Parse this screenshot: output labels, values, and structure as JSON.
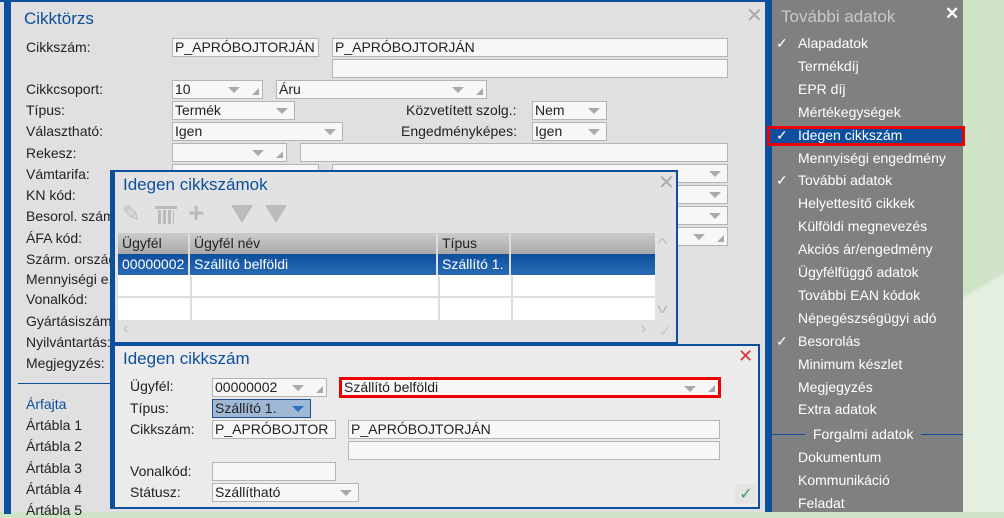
{
  "main": {
    "title": "Cikktörzs",
    "labels": {
      "cikkszam": "Cikkszám:",
      "cikkcsoport": "Cikkcsoport:",
      "tipus": "Típus:",
      "valaszthato": "Választható:",
      "rekesz": "Rekesz:",
      "vamtarifa": "Vámtarifa:",
      "kn": "KN kód:",
      "besorol": "Besorol. szám:",
      "afa": "ÁFA kód:",
      "szarm": "Szárm. ország:",
      "menny": "Mennyiségi e.:",
      "vonalkod": "Vonalkód:",
      "gyartasi": "Gyártásiszám:",
      "nyilv": "Nyilvántartás:",
      "megj": "Megjegyzés:",
      "kozv": "Közvetített szolg.:",
      "engedm": "Engedményképes:"
    },
    "values": {
      "cikkszam1": "P_APRÓBOJTORJÁN",
      "cikkszam2": "P_APRÓBOJTORJÁN",
      "cikkcsoport": "10",
      "cikkcsoport_name": "Áru",
      "tipus": "Termék",
      "valaszthato": "Igen",
      "kozv": "Nem",
      "engedm": "Igen"
    },
    "arfajta": "Árfajta",
    "artablak": [
      "Ártábla 1",
      "Ártábla 2",
      "Ártábla 3",
      "Ártábla 4",
      "Ártábla 5"
    ]
  },
  "list_dialog": {
    "title": "Idegen cikkszámok",
    "columns": [
      "Ügyfél",
      "Ügyfél név",
      "Típus"
    ],
    "rows": [
      {
        "ugyfel": "00000002",
        "nev": "Szállító belföldi",
        "tipus": "Szállító 1."
      }
    ]
  },
  "edit_dialog": {
    "title": "Idegen cikkszám",
    "labels": {
      "ugyfel": "Ügyfél:",
      "tipus": "Típus:",
      "cikkszam": "Cikkszám:",
      "vonalkod": "Vonalkód:",
      "statusz": "Státusz:"
    },
    "values": {
      "ugyfel": "00000002",
      "ugyfel_nev": "Szállító belföldi",
      "tipus": "Szállító 1.",
      "cikkszam1": "P_APRÓBOJTOR",
      "cikkszam2": "P_APRÓBOJTORJÁN",
      "vonalkod": "",
      "statusz": "Szállítható"
    }
  },
  "side": {
    "title": "További adatok",
    "items": [
      {
        "label": "Alapadatok",
        "checked": true
      },
      {
        "label": "Termékdíj"
      },
      {
        "label": "EPR díj"
      },
      {
        "label": "Mértékegységek"
      },
      {
        "label": "Idegen cikkszám",
        "checked": true,
        "selected": true
      },
      {
        "label": "Mennyiségi engedmény"
      },
      {
        "label": "További adatok",
        "checked": true
      },
      {
        "label": "Helyettesítő cikkek"
      },
      {
        "label": "Külföldi megnevezés"
      },
      {
        "label": "Akciós ár/engedmény"
      },
      {
        "label": "Ügyfélfüggő adatok"
      },
      {
        "label": "További EAN kódok"
      },
      {
        "label": "Népegészségügyi adó"
      },
      {
        "label": "Besorolás",
        "checked": true
      },
      {
        "label": "Minimum készlet"
      },
      {
        "label": "Megjegyzés"
      },
      {
        "label": "Extra adatok"
      }
    ],
    "section": "Forgalmi adatok",
    "items2": [
      {
        "label": "Dokumentum"
      },
      {
        "label": "Kommunikáció"
      },
      {
        "label": "Feladat"
      }
    ]
  }
}
